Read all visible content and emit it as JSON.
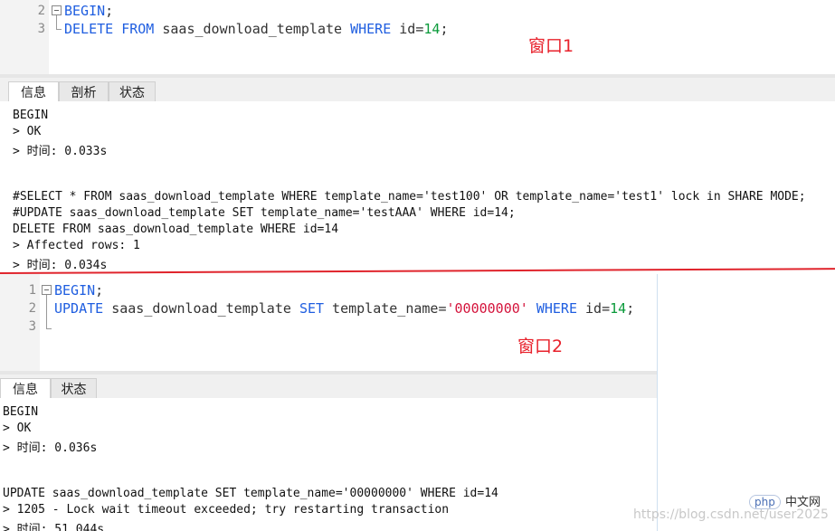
{
  "window1": {
    "label": "窗口1",
    "code_lines": [
      {
        "num": "2",
        "tokens": [
          {
            "t": "BEGIN",
            "c": "kw"
          },
          {
            "t": ";",
            "c": ""
          }
        ]
      },
      {
        "num": "3",
        "tokens": [
          {
            "t": "DELETE FROM",
            "c": "kw"
          },
          {
            "t": " saas_download_template ",
            "c": ""
          },
          {
            "t": "WHERE",
            "c": "kw"
          },
          {
            "t": " id=",
            "c": ""
          },
          {
            "t": "14",
            "c": "num"
          },
          {
            "t": ";",
            "c": ""
          }
        ]
      }
    ],
    "tabs": [
      "信息",
      "剖析",
      "状态"
    ],
    "output": [
      "BEGIN",
      "> OK",
      "> 时间: 0.033s",
      "",
      "",
      "#SELECT * FROM saas_download_template WHERE template_name='test100' OR template_name='test1' lock in SHARE MODE;",
      "#UPDATE saas_download_template SET template_name='testAAA' WHERE id=14;",
      "DELETE FROM saas_download_template WHERE id=14",
      "> Affected rows: 1",
      "> 时间: 0.034s"
    ]
  },
  "window2": {
    "label": "窗口2",
    "code_lines": [
      {
        "num": "1",
        "tokens": [
          {
            "t": "BEGIN",
            "c": "kw"
          },
          {
            "t": ";",
            "c": ""
          }
        ]
      },
      {
        "num": "2",
        "tokens": [
          {
            "t": "UPDATE",
            "c": "kw"
          },
          {
            "t": " saas_download_template ",
            "c": ""
          },
          {
            "t": "SET",
            "c": "kw"
          },
          {
            "t": " template_name=",
            "c": ""
          },
          {
            "t": "'00000000'",
            "c": "str"
          },
          {
            "t": " ",
            "c": ""
          },
          {
            "t": "WHERE",
            "c": "kw"
          },
          {
            "t": " id=",
            "c": ""
          },
          {
            "t": "14",
            "c": "num"
          },
          {
            "t": ";",
            "c": ""
          }
        ]
      },
      {
        "num": "3",
        "tokens": []
      }
    ],
    "tabs": [
      "信息",
      "状态"
    ],
    "output": [
      "BEGIN",
      "> OK",
      "> 时间: 0.036s",
      "",
      "",
      "UPDATE saas_download_template SET template_name='00000000' WHERE id=14",
      "> 1205 - Lock wait timeout exceeded; try restarting transaction",
      "> 时间: 51.044s"
    ]
  },
  "watermark": {
    "logo": "php",
    "site": "中文网",
    "url": "https://blog.csdn.net/user2025"
  },
  "colors": {
    "keyword": "#1f5ee0",
    "number": "#0a9a3a",
    "string": "#d4143c",
    "annotation": "#e8212b"
  }
}
